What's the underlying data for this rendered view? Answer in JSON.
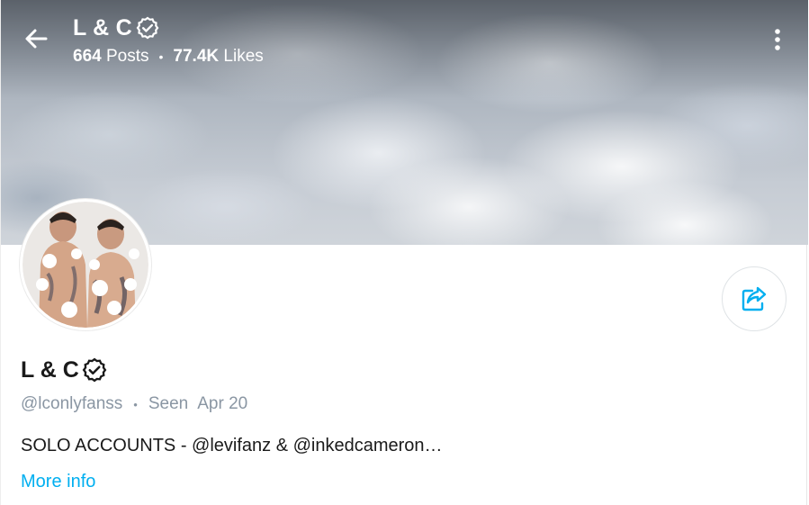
{
  "header": {
    "name": "L & C",
    "posts_count": "664",
    "posts_label": "Posts",
    "separator": "•",
    "likes_count": "77.4K",
    "likes_label": "Likes"
  },
  "profile": {
    "name": "L & C",
    "username": "@lconlyfanss",
    "separator": "•",
    "seen_label": "Seen",
    "seen_date": "Apr 20",
    "bio": "SOLO ACCOUNTS - @levifanz & @inkedcameron…",
    "more_info": "More info"
  },
  "colors": {
    "accent": "#00aff0",
    "muted": "#8a96a3",
    "text": "#1a1a1a"
  },
  "icons": [
    "back-arrow-icon",
    "verified-badge-icon",
    "more-vertical-icon",
    "share-icon"
  ]
}
